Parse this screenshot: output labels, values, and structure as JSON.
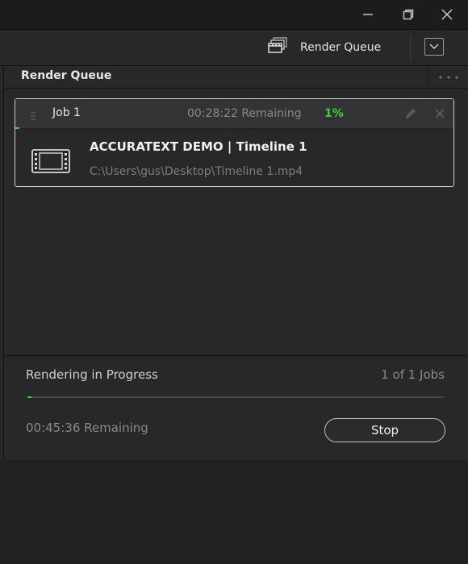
{
  "window": {
    "minimize_icon": "minimize-icon",
    "restore_icon": "restore-icon",
    "close_icon": "close-icon"
  },
  "toolbar": {
    "render_queue_label": "Render Queue",
    "render_queue_icon": "render-queue-icon",
    "dropdown_icon": "chevron-down-icon"
  },
  "panel": {
    "title": "Render Queue",
    "menu_icon": "more-horizontal-icon"
  },
  "job": {
    "title": "Job 1",
    "remaining": "00:28:22 Remaining",
    "percent": "1%",
    "progress_fraction": 0.01,
    "name": "ACCURATEXT DEMO | Timeline 1",
    "path": "C:\\Users\\gus\\Desktop\\Timeline 1.mp4",
    "thumbnail_icon": "film-icon"
  },
  "progress": {
    "label": "Rendering in Progress",
    "count": "1 of 1 Jobs",
    "remaining": "00:45:36 Remaining",
    "fraction": 0.01,
    "stop_label": "Stop"
  },
  "colors": {
    "accent_green": "#3fd03f",
    "background": "#222225",
    "panel": "#28282b"
  }
}
